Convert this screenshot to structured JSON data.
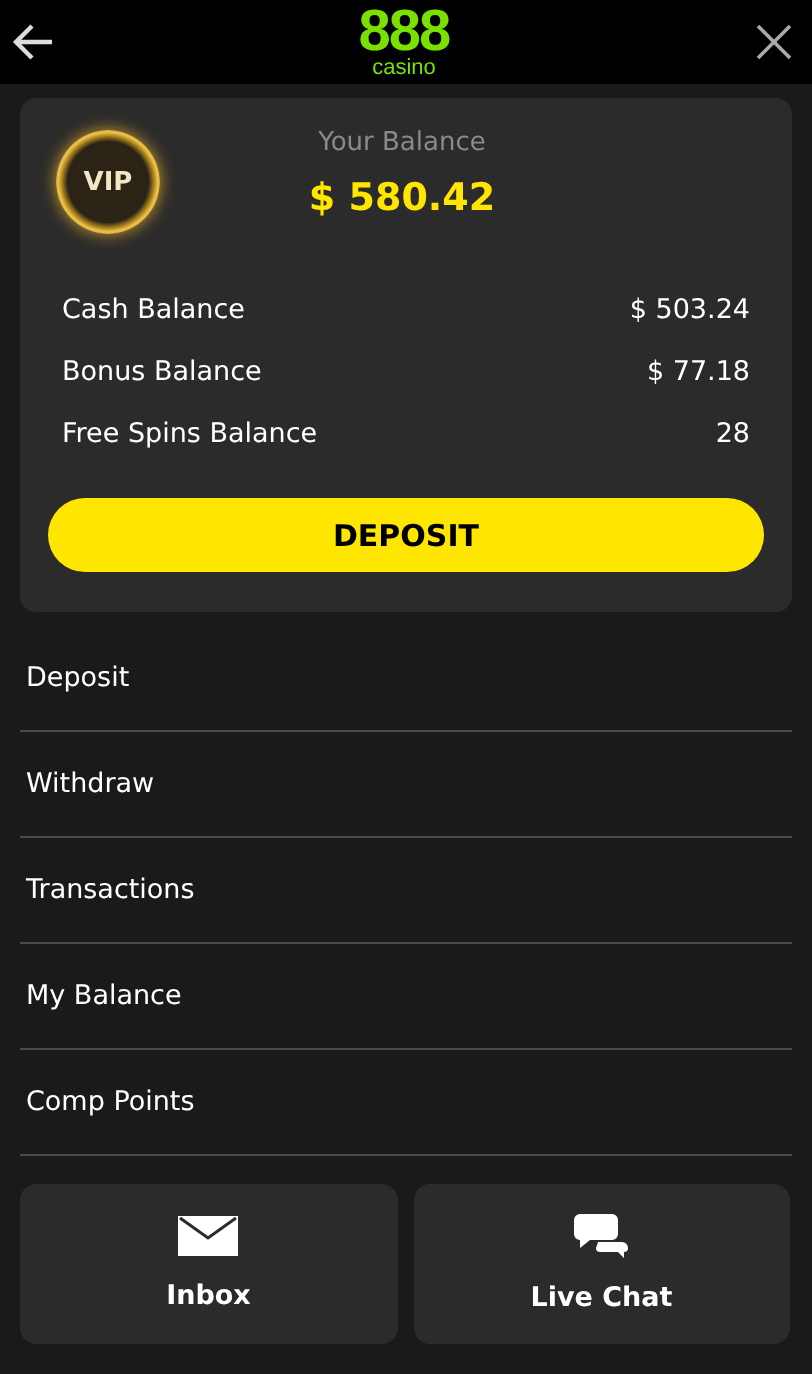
{
  "header": {
    "logo_number": "888",
    "logo_word": "casino"
  },
  "balance_card": {
    "vip_badge": "VIP",
    "title": "Your Balance",
    "total": "$ 580.42",
    "rows": [
      {
        "label": "Cash Balance",
        "value": "$ 503.24"
      },
      {
        "label": "Bonus Balance",
        "value": "$ 77.18"
      },
      {
        "label": "Free Spins Balance",
        "value": "28"
      }
    ],
    "deposit_button": "DEPOSIT"
  },
  "menu": [
    "Deposit",
    "Withdraw",
    "Transactions",
    "My Balance",
    "Comp Points"
  ],
  "footer_buttons": [
    {
      "kind": "inbox",
      "label": "Inbox"
    },
    {
      "kind": "chat",
      "label": "Live Chat"
    }
  ]
}
